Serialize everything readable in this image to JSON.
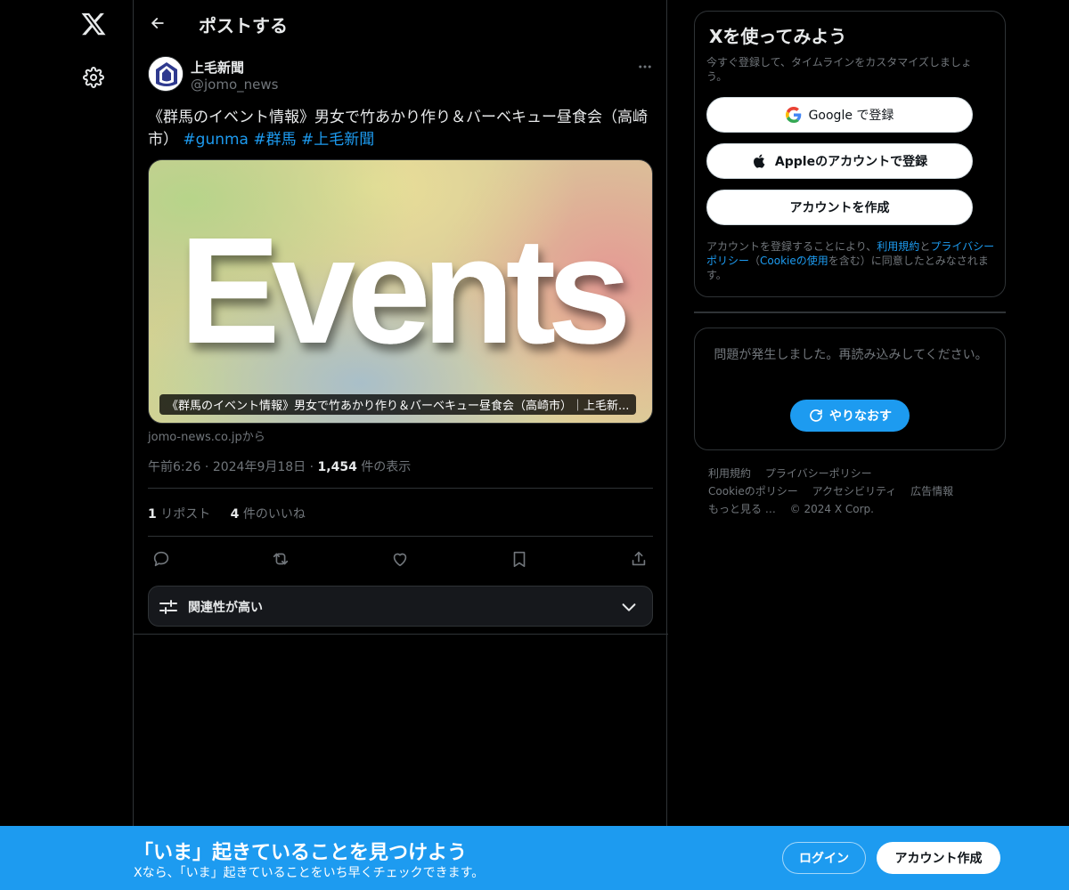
{
  "nav": {
    "logo_icon": "x-logo-icon",
    "settings_icon": "gear-icon"
  },
  "header": {
    "title": "ポストする"
  },
  "post": {
    "author_name": "上毛新聞",
    "author_handle": "@jomo_news",
    "text": "《群馬のイベント情報》男女で竹あかり作り＆バーベキュー昼食会（高崎市）",
    "hashtags": [
      "#gunma",
      "#群馬",
      "#上毛新聞"
    ],
    "card": {
      "image_text": "Events",
      "caption": "《群馬のイベント情報》男女で竹あかり作り＆バーベキュー昼食会（高崎市）｜上毛新...",
      "source": "jomo-news.co.jpから"
    },
    "time": "午前6:26",
    "date": "2024年9月18日",
    "views_count": "1,454",
    "views_label": "件の表示",
    "reposts_count": "1",
    "reposts_label": "リポスト",
    "likes_count": "4",
    "likes_label": "件のいいね"
  },
  "relevance": {
    "label": "関連性が高い"
  },
  "signup": {
    "title": "Xを使ってみよう",
    "subtitle": "今すぐ登録して、タイムラインをカスタマイズしましょう。",
    "google_label": "Google で登録",
    "apple_label": "Appleのアカウントで登録",
    "create_label": "アカウントを作成",
    "legal_prefix": "アカウントを登録することにより、",
    "legal_terms": "利用規約",
    "legal_and": "と",
    "legal_privacy": "プライバシーポリシー",
    "legal_paren_open": "（",
    "legal_cookie": "Cookieの使用",
    "legal_suffix": "を含む）に同意したとみなされます。"
  },
  "error": {
    "message": "問題が発生しました。再読み込みしてください。",
    "retry_label": "やりなおす"
  },
  "footer": {
    "links": [
      "利用規約",
      "プライバシーポリシー",
      "Cookieのポリシー",
      "アクセシビリティ",
      "広告情報",
      "もっと見る …"
    ],
    "copyright": "© 2024 X Corp."
  },
  "banner": {
    "title": "「いま」起きていることを見つけよう",
    "subtitle": "Xなら、「いま」起きていることをいち早くチェックできます。",
    "login_label": "ログイン",
    "create_label": "アカウント作成"
  },
  "colors": {
    "accent": "#1d9bf0",
    "background": "#000000",
    "border": "#2f3336",
    "muted_text": "#71767b"
  }
}
